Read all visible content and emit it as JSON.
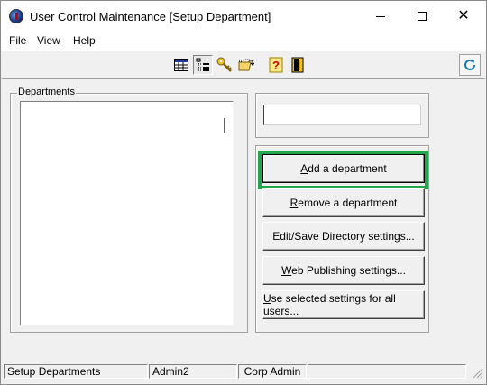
{
  "window": {
    "title": "User Control Maintenance [Setup Department]",
    "icon": "app-globe-icon"
  },
  "menu": {
    "items": [
      "File",
      "View",
      "Help"
    ]
  },
  "toolbar": {
    "buttons": [
      {
        "name": "table-view-icon",
        "pressed": false
      },
      {
        "name": "tree-view-icon",
        "pressed": true
      },
      {
        "name": "key-icon",
        "pressed": false
      },
      {
        "name": "folder-open-icon",
        "pressed": false
      },
      {
        "name": "help-icon",
        "pressed": false
      },
      {
        "name": "exit-door-icon",
        "pressed": false
      },
      {
        "name": "refresh-icon",
        "pressed": false
      }
    ]
  },
  "departments": {
    "legend": "Departments",
    "items": []
  },
  "department_name": {
    "value": "",
    "placeholder": ""
  },
  "actions": {
    "add": "Add a department",
    "add_accel": "A",
    "add_rest": "dd a department",
    "remove_accel": "R",
    "remove_rest": "emove a department",
    "editsave": "Edit/Save Directory settings...",
    "web_accel": "W",
    "web_rest": "eb Publishing settings...",
    "useall_accel": "U",
    "useall_rest": "se selected settings for all users..."
  },
  "highlight_color": "#21a64a",
  "status": {
    "mode": "Setup Departments",
    "user": "Admin2",
    "company": "Corp Admin",
    "extra": ""
  }
}
